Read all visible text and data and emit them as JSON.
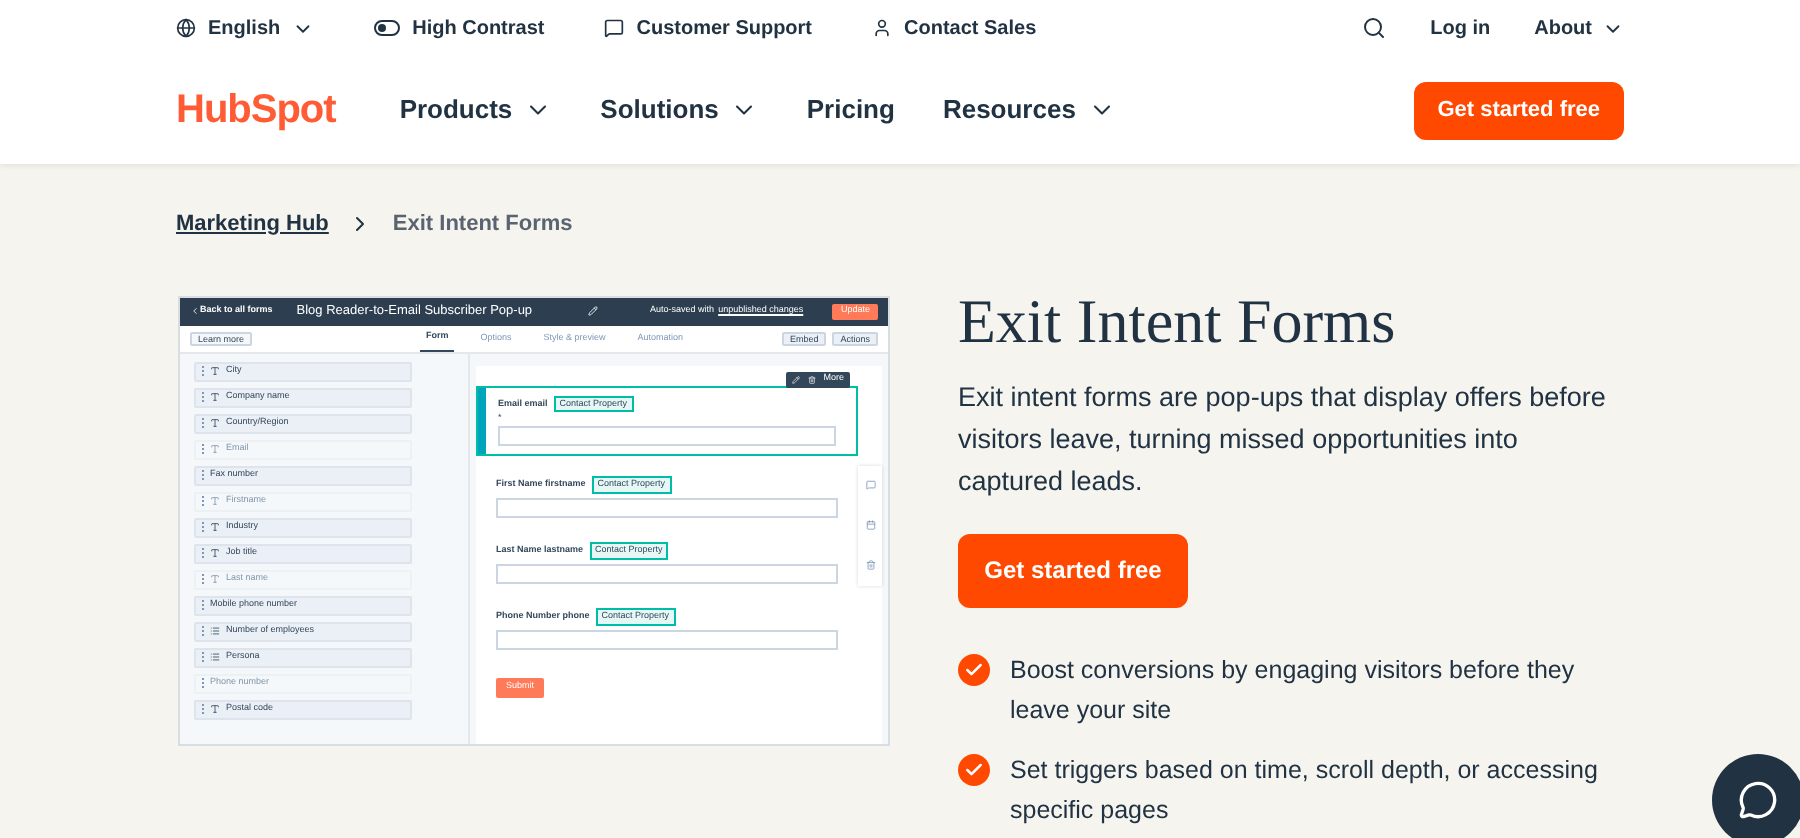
{
  "top_bar": {
    "language": "English",
    "high_contrast": "High Contrast",
    "support": "Customer Support",
    "sales": "Contact Sales",
    "login": "Log in",
    "about": "About"
  },
  "nav": {
    "logo": "HubSpot",
    "items": [
      {
        "label": "Products",
        "dropdown": true
      },
      {
        "label": "Solutions",
        "dropdown": true
      },
      {
        "label": "Pricing",
        "dropdown": false
      },
      {
        "label": "Resources",
        "dropdown": true
      }
    ],
    "cta": "Get started free"
  },
  "breadcrumb": {
    "parent": "Marketing Hub",
    "current": "Exit Intent Forms"
  },
  "editor": {
    "back": "Back to all forms",
    "title": "Blog Reader-to-Email Subscriber Pop-up",
    "autosave": "Auto-saved with",
    "autosave_link": "unpublished changes",
    "update": "Update",
    "learn_more": "Learn more",
    "tabs": [
      {
        "label": "Form",
        "selected": true
      },
      {
        "label": "Options",
        "selected": false
      },
      {
        "label": "Style & preview",
        "selected": false
      },
      {
        "label": "Automation",
        "selected": false
      }
    ],
    "embed": "Embed",
    "actions": "Actions",
    "fields": [
      {
        "label": "City",
        "kind": "text",
        "disabled": false
      },
      {
        "label": "Company name",
        "kind": "text",
        "disabled": false
      },
      {
        "label": "Country/Region",
        "kind": "text",
        "disabled": false
      },
      {
        "label": "Email",
        "kind": "text",
        "disabled": true
      },
      {
        "label": "Fax number",
        "kind": "plain",
        "disabled": false
      },
      {
        "label": "Firstname",
        "kind": "text",
        "disabled": true
      },
      {
        "label": "Industry",
        "kind": "text",
        "disabled": false
      },
      {
        "label": "Job title",
        "kind": "text",
        "disabled": false
      },
      {
        "label": "Last name",
        "kind": "text",
        "disabled": true
      },
      {
        "label": "Mobile phone number",
        "kind": "plain",
        "disabled": false
      },
      {
        "label": "Number of employees",
        "kind": "select",
        "disabled": false
      },
      {
        "label": "Persona",
        "kind": "select",
        "disabled": false
      },
      {
        "label": "Phone number",
        "kind": "plain",
        "disabled": true
      },
      {
        "label": "Postal code",
        "kind": "text",
        "disabled": false
      }
    ],
    "more": "More",
    "form_fields": [
      {
        "label": "Email email",
        "badge": "Contact Property",
        "required": "*",
        "selected": true
      },
      {
        "label": "First Name firstname",
        "badge": "Contact Property",
        "selected": false
      },
      {
        "label": "Last Name lastname",
        "badge": "Contact Property",
        "selected": false
      },
      {
        "label": "Phone Number phone",
        "badge": "Contact Property",
        "selected": false
      }
    ],
    "submit": "Submit"
  },
  "hero": {
    "title": "Exit Intent Forms",
    "description": "Exit intent forms are pop-ups that display offers before visitors leave, turning missed opportunities into captured leads.",
    "cta": "Get started free",
    "features": [
      "Boost conversions by engaging visitors before they leave your site",
      "Set triggers based on time, scroll depth, or accessing specific pages"
    ]
  }
}
